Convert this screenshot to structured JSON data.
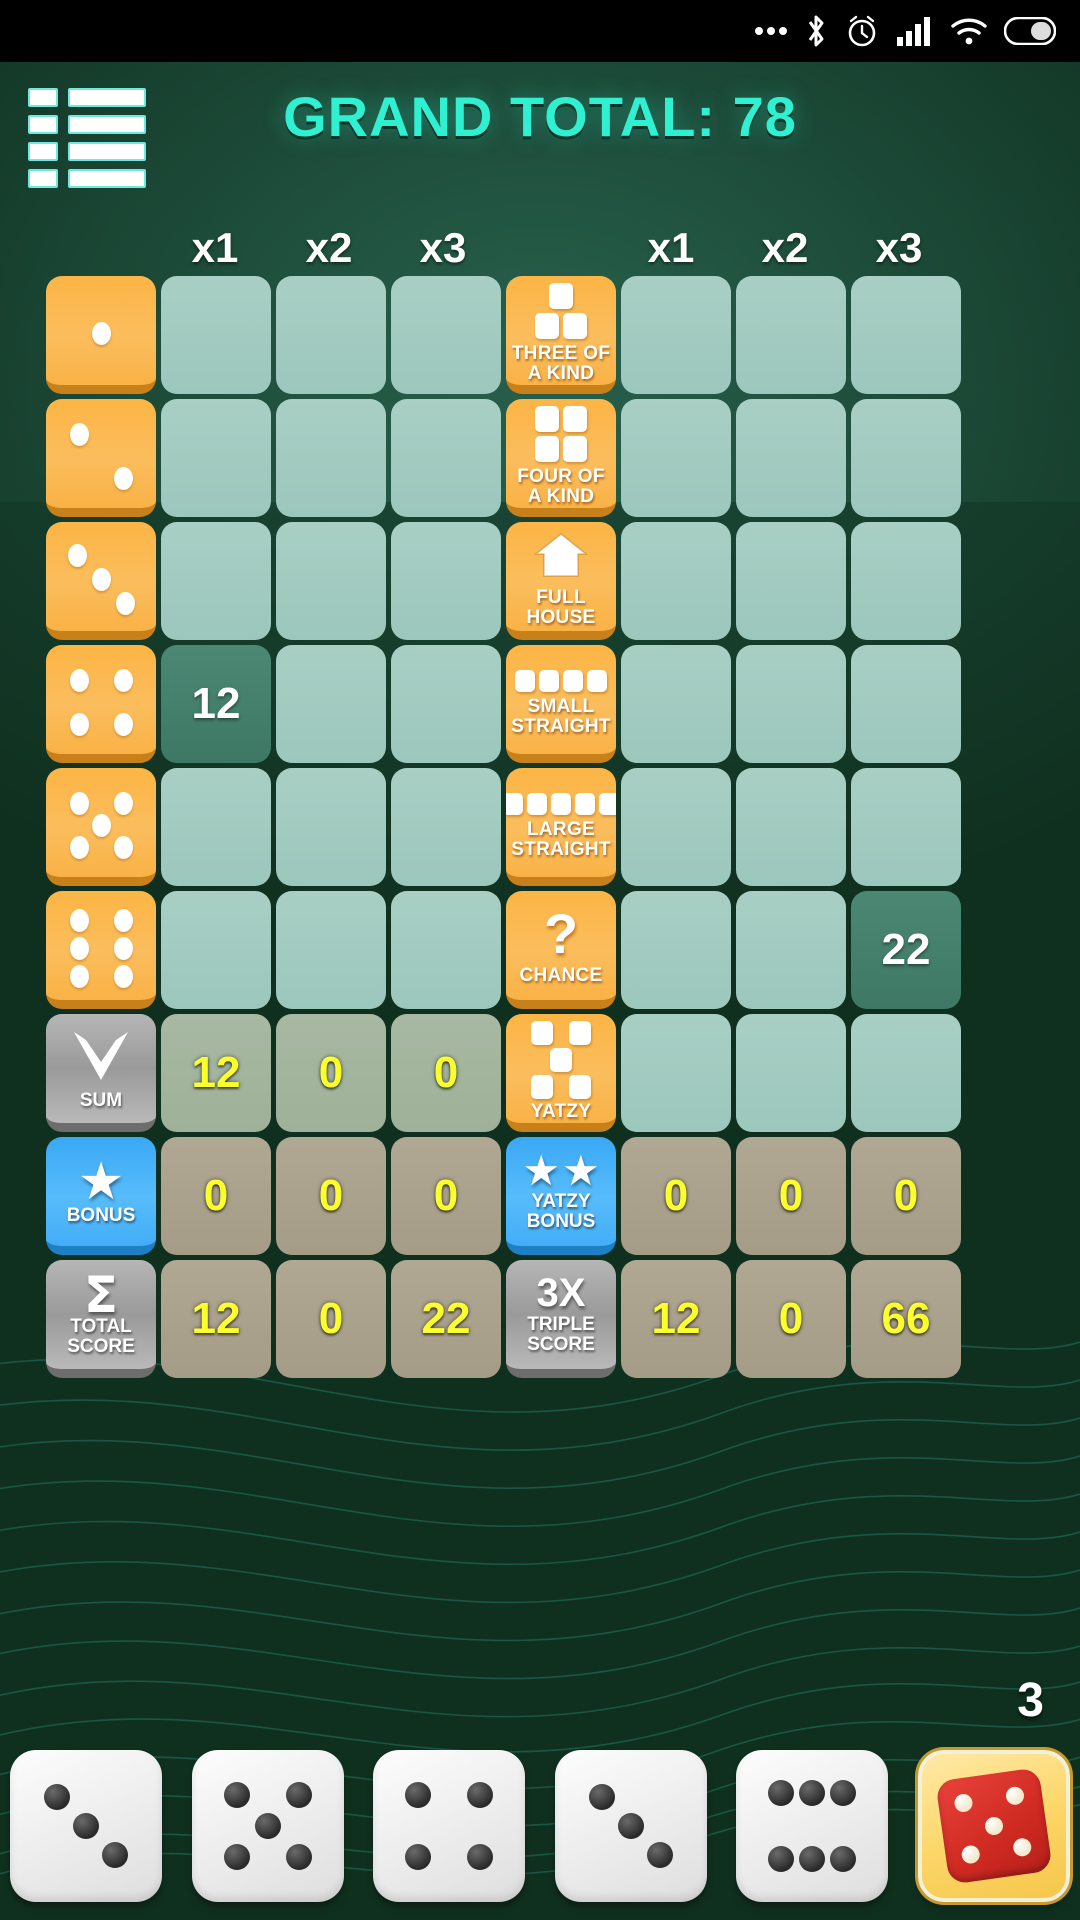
{
  "statusbar": {
    "icons": [
      "more-dots-icon",
      "bluetooth-icon",
      "alarm-icon",
      "signal-icon",
      "wifi-icon",
      "battery-icon"
    ]
  },
  "header": {
    "menu_label": "menu-icon",
    "grand_total": "GRAND TOTAL: 78",
    "grand_total_value": 78,
    "accent_color": "#2ff0d0"
  },
  "column_headers": [
    "",
    "x1",
    "x2",
    "x3",
    "",
    "x1",
    "x2",
    "x3"
  ],
  "rows": [
    {
      "left_label": "die-1",
      "left_type": "dice",
      "left_pips": 1,
      "left_scores": [
        "",
        "",
        ""
      ],
      "right_label": "THREE OF A KIND",
      "right_type": "three-of-a-kind",
      "right_scores": [
        "",
        "",
        ""
      ]
    },
    {
      "left_label": "die-2",
      "left_type": "dice",
      "left_pips": 2,
      "left_scores": [
        "",
        "",
        ""
      ],
      "right_label": "FOUR OF A KIND",
      "right_type": "four-of-a-kind",
      "right_scores": [
        "",
        "",
        ""
      ]
    },
    {
      "left_label": "die-3",
      "left_type": "dice",
      "left_pips": 3,
      "left_scores": [
        "",
        "",
        ""
      ],
      "right_label": "FULL HOUSE",
      "right_type": "full-house",
      "right_scores": [
        "",
        "",
        ""
      ]
    },
    {
      "left_label": "die-4",
      "left_type": "dice",
      "left_pips": 4,
      "left_scores": [
        "12",
        "",
        ""
      ],
      "right_label": "SMALL STRAIGHT",
      "right_type": "small-straight",
      "right_scores": [
        "",
        "",
        ""
      ]
    },
    {
      "left_label": "die-5",
      "left_type": "dice",
      "left_pips": 5,
      "left_scores": [
        "",
        "",
        ""
      ],
      "right_label": "LARGE STRAIGHT",
      "right_type": "large-straight",
      "right_scores": [
        "",
        "",
        ""
      ]
    },
    {
      "left_label": "die-6",
      "left_type": "dice",
      "left_pips": 6,
      "left_scores": [
        "",
        "",
        ""
      ],
      "right_label": "CHANCE",
      "right_type": "chance",
      "right_scores": [
        "",
        "",
        "22"
      ]
    },
    {
      "left_label": "SUM",
      "left_type": "sum",
      "left_scores": [
        "12",
        "0",
        "0"
      ],
      "right_label": "YATZY",
      "right_type": "yatzy",
      "right_scores": [
        "",
        "",
        ""
      ]
    },
    {
      "left_label": "BONUS",
      "left_type": "bonus",
      "left_scores": [
        "0",
        "0",
        "0"
      ],
      "right_label": "YATZY BONUS",
      "right_type": "yatzy-bonus",
      "right_scores": [
        "0",
        "0",
        "0"
      ]
    },
    {
      "left_label": "TOTAL SCORE",
      "left_type": "total",
      "left_scores": [
        "12",
        "0",
        "22"
      ],
      "right_label": "3X TRIPLE SCORE",
      "right_type": "triple-score",
      "right_scores": [
        "12",
        "0",
        "66"
      ]
    }
  ],
  "labels": {
    "three_of_a_kind": [
      "THREE OF",
      "A KIND"
    ],
    "four_of_a_kind": [
      "FOUR OF",
      "A KIND"
    ],
    "full_house": [
      "FULL",
      "HOUSE"
    ],
    "small_straight": [
      "SMALL",
      "STRAIGHT"
    ],
    "large_straight": [
      "LARGE",
      "STRAIGHT"
    ],
    "chance": [
      "CHANCE"
    ],
    "yatzy": [
      "YATZY"
    ],
    "yatzy_bonus": [
      "YATZY",
      "BONUS"
    ],
    "sum": [
      "SUM"
    ],
    "bonus": [
      "BONUS"
    ],
    "total_score": [
      "TOTAL",
      "SCORE"
    ],
    "triple_title": "3X",
    "triple_score": [
      "TRIPLE",
      "SCORE"
    ]
  },
  "dice_tray": {
    "rolls_left": "3",
    "dice": [
      3,
      5,
      4,
      3,
      6
    ],
    "roll_button": "roll-dice-button",
    "roll_button_face": 5
  },
  "colors": {
    "accent": "#2ff0d0",
    "score_yellow": "#fbff2b",
    "category_orange": "#fbbd5d",
    "bonus_blue": "#44adf6",
    "grey_button": "#9a9a9a"
  }
}
